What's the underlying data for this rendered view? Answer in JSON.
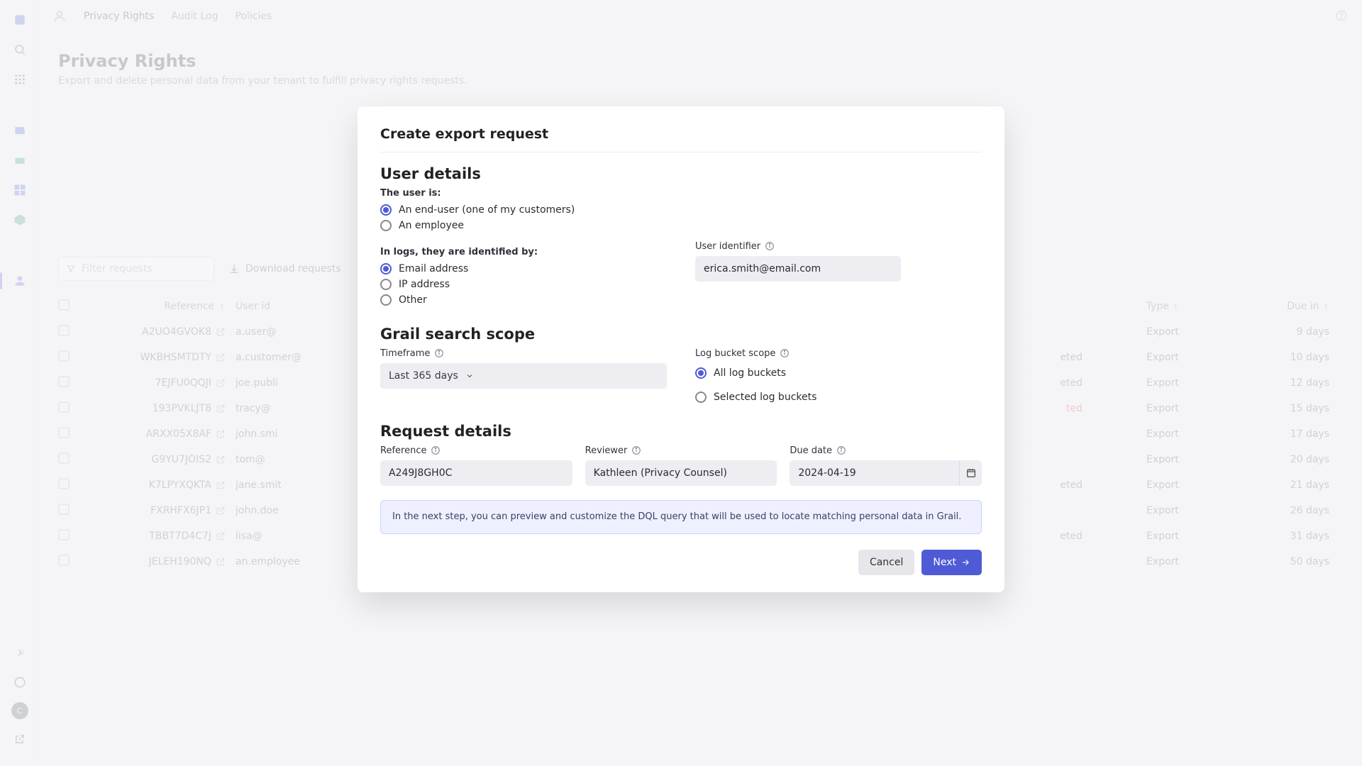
{
  "colors": {
    "accent": "#4f5bd5"
  },
  "rail": {
    "avatar_initial": "C"
  },
  "topbar": {
    "tabs": {
      "t0": "Privacy Rights",
      "t1": "Audit Log",
      "t2": "Policies"
    }
  },
  "page": {
    "title": "Privacy Rights",
    "subtitle": "Export and delete personal data from your tenant to fulfill privacy rights requests."
  },
  "table": {
    "filter_placeholder": "Filter requests",
    "download_label": "Download requests",
    "cols": {
      "ref": "Reference",
      "user": "User id",
      "status_mid": "",
      "type": "Type",
      "due": "Due in"
    },
    "rows": [
      {
        "ref": "A2UO4GVOK8",
        "user": "a.user@",
        "mid": "",
        "midwarn": true,
        "type": "Export",
        "due": "9 days"
      },
      {
        "ref": "WKBHSMTDTY",
        "user": "a.customer@",
        "mid": "eted",
        "midwarn": false,
        "type": "Export",
        "due": "10 days"
      },
      {
        "ref": "7EJFU0QQJI",
        "user": "joe.publi",
        "mid": "eted",
        "midwarn": false,
        "type": "Export",
        "due": "12 days"
      },
      {
        "ref": "193PVKLJT8",
        "user": "tracy@",
        "mid": "ted",
        "midwarn": false,
        "middanger": true,
        "type": "Export",
        "due": "15 days"
      },
      {
        "ref": "ARXX05X8AF",
        "user": "john.smi",
        "mid": "",
        "midwarn": true,
        "type": "Export",
        "due": "17 days"
      },
      {
        "ref": "G9YU7JOIS2",
        "user": "tom@",
        "mid": "",
        "midwarn": true,
        "type": "Export",
        "due": "20 days"
      },
      {
        "ref": "K7LPYXQKTA",
        "user": "jane.smit",
        "mid": "eted",
        "midwarn": false,
        "type": "Export",
        "due": "21 days"
      },
      {
        "ref": "FXRHFX6JP1",
        "user": "john.doe",
        "mid": "",
        "midwarn": true,
        "type": "Export",
        "due": "26 days"
      },
      {
        "ref": "TBBT7D4C7J",
        "user": "lisa@",
        "mid": "eted",
        "midwarn": false,
        "type": "Export",
        "due": "31 days"
      },
      {
        "ref": "JELEH190NQ",
        "user": "an.employee",
        "mid": "",
        "midwarn": true,
        "type": "Export",
        "due": "50 days"
      }
    ]
  },
  "modal": {
    "title": "Create export request",
    "section1": "User details",
    "user_is_label": "The user is:",
    "user_type": {
      "opt_enduser": "An end-user (one of my customers)",
      "opt_employee": "An employee",
      "selected": "enduser"
    },
    "identified_by_label": "In logs, they are identified by:",
    "ident_opts": {
      "email": "Email address",
      "ip": "IP address",
      "other": "Other",
      "selected": "email"
    },
    "user_identifier_label": "User identifier",
    "user_identifier_value": "erica.smith@email.com",
    "section2": "Grail search scope",
    "timeframe_label": "Timeframe",
    "timeframe_value": "Last 365 days",
    "bucket_scope_label": "Log bucket scope",
    "bucket_opts": {
      "all": "All log buckets",
      "sel": "Selected log buckets",
      "selected": "all"
    },
    "section3": "Request details",
    "reference_label": "Reference",
    "reference_value": "A249J8GH0C",
    "reviewer_label": "Reviewer",
    "reviewer_value": "Kathleen (Privacy Counsel)",
    "due_label": "Due date",
    "due_value": "2024-04-19",
    "hint": "In the next step, you can preview and customize the DQL query that will be used to locate matching personal data in Grail.",
    "cancel": "Cancel",
    "next": "Next"
  }
}
